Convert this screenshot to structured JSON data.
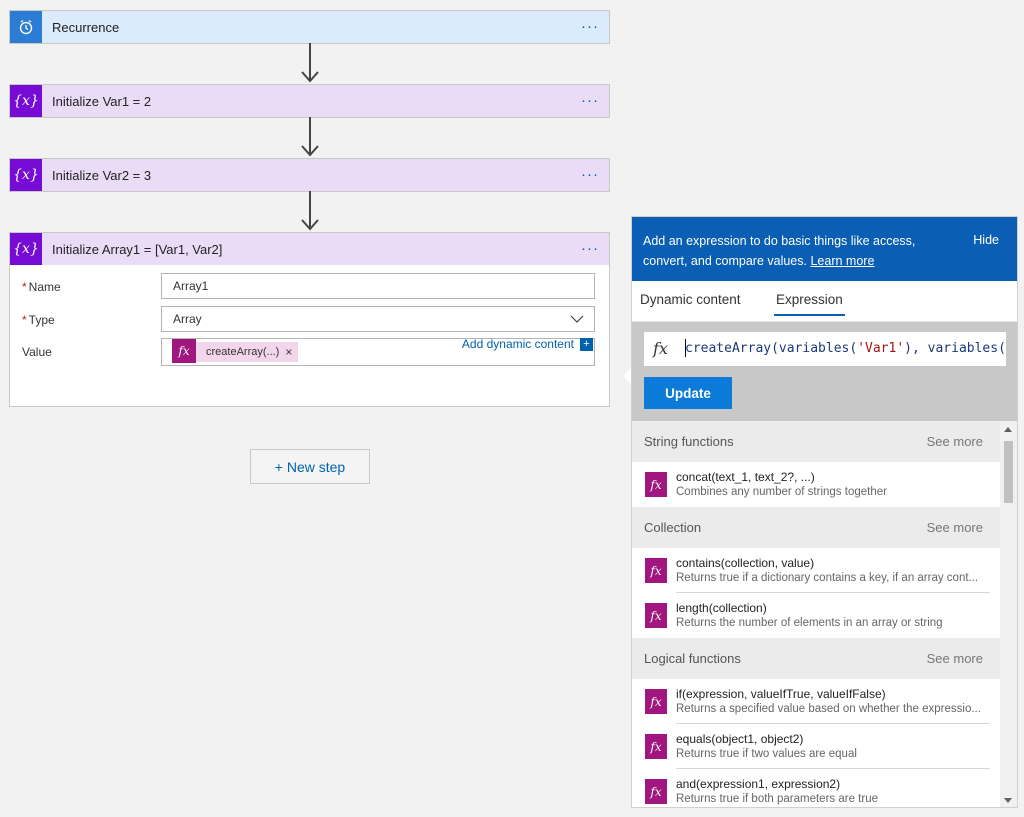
{
  "flow": {
    "recurrence": {
      "title": "Recurrence",
      "icon": "alarm-clock-icon"
    },
    "var1": {
      "title": "Initialize Var1 = 2",
      "icon": "variable-icon"
    },
    "var2": {
      "title": "Initialize Var2 = 3",
      "icon": "variable-icon"
    },
    "array1": {
      "title": "Initialize Array1 = [Var1, Var2]",
      "icon": "variable-icon",
      "name_label": "Name",
      "name_value": "Array1",
      "type_label": "Type",
      "type_value": "Array",
      "value_label": "Value",
      "value_token": "createArray(...)",
      "add_dynamic": "Add dynamic content"
    },
    "more_glyph": "···",
    "required_mark": "*",
    "new_step": "+ New step"
  },
  "panel": {
    "description": "Add an expression to do basic things like access, convert, and compare values.",
    "learn_more": "Learn more",
    "hide": "Hide",
    "tabs": [
      "Dynamic content",
      "Expression"
    ],
    "active_tab": "Expression",
    "fx_label": "fx",
    "expression_prefix": "createArray(variables(",
    "expression_str1": "'Var1'",
    "expression_mid": "), variables(",
    "expression_str2": "'",
    "update": "Update",
    "see_more": "See more",
    "categories": [
      {
        "name": "String functions",
        "functions": [
          {
            "sig": "concat(text_1, text_2?, ...)",
            "desc": "Combines any number of strings together"
          }
        ]
      },
      {
        "name": "Collection",
        "functions": [
          {
            "sig": "contains(collection, value)",
            "desc": "Returns true if a dictionary contains a key, if an array cont..."
          },
          {
            "sig": "length(collection)",
            "desc": "Returns the number of elements in an array or string"
          }
        ]
      },
      {
        "name": "Logical functions",
        "functions": [
          {
            "sig": "if(expression, valueIfTrue, valueIfFalse)",
            "desc": "Returns a specified value based on whether the expressio..."
          },
          {
            "sig": "equals(object1, object2)",
            "desc": "Returns true if two values are equal"
          },
          {
            "sig": "and(expression1, expression2)",
            "desc": "Returns true if both parameters are true"
          }
        ]
      }
    ]
  },
  "colors": {
    "accent": "#0a5fb4",
    "variable": "#770bd6",
    "recurrence": "#2b7cd3",
    "function": "#a0157e"
  }
}
